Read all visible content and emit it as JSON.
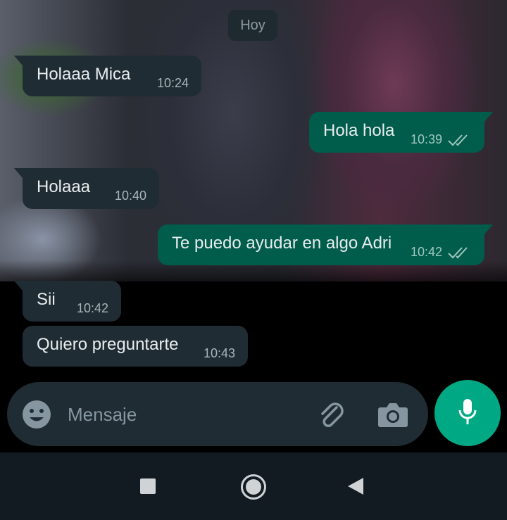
{
  "chat": {
    "date_label": "Hoy",
    "messages": [
      {
        "direction": "in",
        "text": "Holaaa Mica",
        "time": "10:24"
      },
      {
        "direction": "out",
        "text": "Hola hola",
        "time": "10:39",
        "status": "read"
      },
      {
        "direction": "in",
        "text": "Holaaa",
        "time": "10:40"
      },
      {
        "direction": "out",
        "text": "Te puedo ayudar en algo Adri",
        "time": "10:42",
        "status": "read"
      },
      {
        "direction": "in",
        "text": "Sii",
        "time": "10:42"
      },
      {
        "direction": "in",
        "text": "Quiero preguntarte",
        "time": "10:43"
      }
    ]
  },
  "composer": {
    "placeholder": "Mensaje",
    "icons": {
      "emoji": "emoji-icon",
      "attach": "paperclip-icon",
      "camera": "camera-icon",
      "mic": "microphone-icon"
    }
  },
  "navigation": {
    "recents": "square-icon",
    "home": "circle-icon",
    "back": "triangle-back-icon"
  },
  "colors": {
    "incoming_bubble": "#1f2c33",
    "outgoing_bubble": "#005c4b",
    "accent": "#00a884",
    "nav_bar": "#121b22"
  }
}
